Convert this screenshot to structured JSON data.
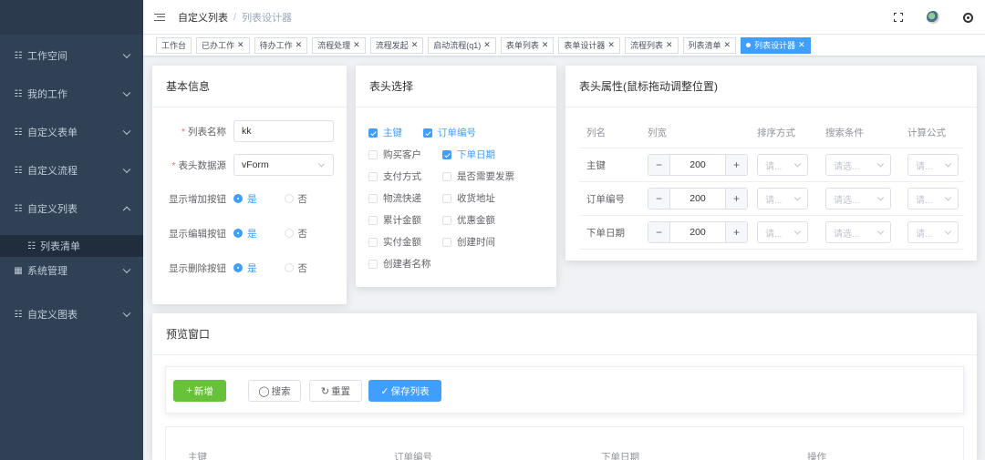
{
  "sidebar": {
    "items": [
      {
        "label": "工作空间",
        "icon": "grid-icon"
      },
      {
        "label": "我的工作",
        "icon": "grid-icon"
      },
      {
        "label": "自定义表单",
        "icon": "grid-icon"
      },
      {
        "label": "自定义流程",
        "icon": "grid-icon"
      },
      {
        "label": "自定义列表",
        "icon": "grid-icon"
      }
    ],
    "subitem": {
      "label": "列表清单",
      "icon": "grid-icon"
    },
    "items_after": [
      {
        "label": "系统管理",
        "icon": "table-icon"
      },
      {
        "label": "自定义图表",
        "icon": "grid-icon"
      }
    ]
  },
  "navbar": {
    "breadcrumb": [
      "自定义列表",
      "列表设计器"
    ]
  },
  "tags": [
    {
      "label": "工作台"
    },
    {
      "label": "已办工作"
    },
    {
      "label": "待办工作"
    },
    {
      "label": "流程处理"
    },
    {
      "label": "流程发起"
    },
    {
      "label": "启动流程(q1)"
    },
    {
      "label": "表单列表"
    },
    {
      "label": "表单设计器"
    },
    {
      "label": "流程列表"
    },
    {
      "label": "列表清单"
    },
    {
      "label": "列表设计器",
      "active": true
    }
  ],
  "basic_info": {
    "title": "基本信息",
    "list_name_label": "列表名称",
    "list_name_value": "kk",
    "datasource_label": "表头数据源",
    "datasource_value": "vForm",
    "show_add_label": "显示增加按钮",
    "show_edit_label": "显示编辑按钮",
    "show_delete_label": "显示删除按钮",
    "yes": "是",
    "no": "否"
  },
  "header_select": {
    "title": "表头选择",
    "fields": [
      {
        "label": "主键",
        "checked": true
      },
      {
        "label": "订单编号",
        "checked": true
      },
      {
        "label": "购买客户",
        "checked": false
      },
      {
        "label": "下单日期",
        "checked": true
      },
      {
        "label": "支付方式",
        "checked": false
      },
      {
        "label": "是否需要发票",
        "checked": false
      },
      {
        "label": "物流快递",
        "checked": false
      },
      {
        "label": "收货地址",
        "checked": false
      },
      {
        "label": "累计金额",
        "checked": false
      },
      {
        "label": "优惠金额",
        "checked": false
      },
      {
        "label": "实付金额",
        "checked": false
      },
      {
        "label": "创建时间",
        "checked": false
      },
      {
        "label": "创建者名称",
        "checked": false
      }
    ]
  },
  "header_props": {
    "title": "表头属性(鼠标拖动调整位置)",
    "columns": [
      "列名",
      "列宽",
      "排序方式",
      "搜索条件",
      "计算公式"
    ],
    "rows": [
      {
        "name": "主键",
        "width": "200"
      },
      {
        "name": "订单编号",
        "width": "200"
      },
      {
        "name": "下单日期",
        "width": "200"
      }
    ],
    "placeholder_sort": "请...",
    "placeholder_search": "请选...",
    "placeholder_formula": "请..."
  },
  "preview": {
    "title": "预览窗口",
    "add_button": "新增",
    "search_button": "搜索",
    "reset_button": "重置",
    "save_button": "保存列表",
    "table_columns": [
      "主键",
      "订单编号",
      "下单日期",
      "操作"
    ]
  },
  "colors": {
    "sidebar_bg": "#304156",
    "primary": "#409eff",
    "success": "#67c23a"
  }
}
